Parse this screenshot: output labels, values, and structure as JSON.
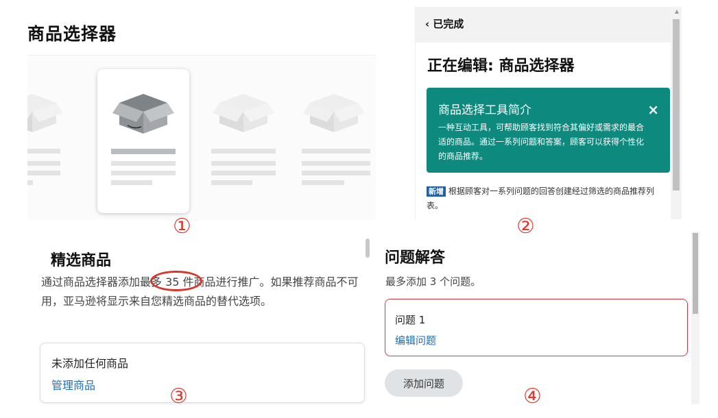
{
  "panel1": {
    "title": "商品选择器",
    "marker": "①"
  },
  "panel2": {
    "back_label": "‹ 已完成",
    "heading": "正在编辑: 商品选择器",
    "info_card": {
      "title": "商品选择工具简介",
      "close_icon": "×",
      "body": "一种互动工具，可帮助顾客找到符合其偏好或需求的最合适的商品。通过一系列问题和答案，顾客可以获得个性化的商品推荐。",
      "background": "#0d8a7d"
    },
    "new_badge": "新增",
    "new_text": "根据顾客对一系列问题的回答创建经过筛选的商品推荐列表。",
    "marker": "②"
  },
  "panel3": {
    "title": "精选商品",
    "description": "通过商品选择器添加最多 35 件商品进行推广。如果推荐商品不可用，亚马逊将显示来自您精选商品的替代选项。",
    "empty_text": "未添加任何商品",
    "manage_link": "管理商品",
    "marker": "③"
  },
  "panel4": {
    "title": "问题解答",
    "subtitle": "最多添加 3 个问题。",
    "question_label": "问题 1",
    "edit_link": "编辑问题",
    "add_button": "添加问题",
    "marker": "④"
  },
  "colors": {
    "marker_red": "#e03a2f",
    "link_blue": "#1f6fb8",
    "teal": "#0d8a7d",
    "error_border": "#d9363e"
  }
}
